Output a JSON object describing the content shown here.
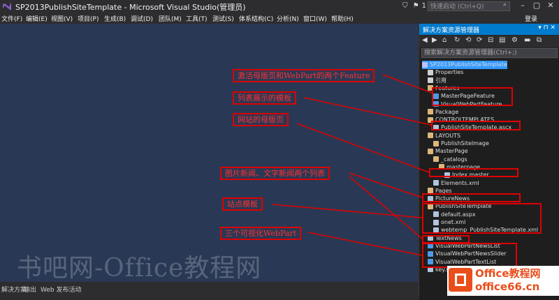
{
  "window": {
    "title": "SP2013PublishSiteTemplate - Microsoft Visual Studio(管理员)",
    "notif_count": "1",
    "quicklaunch_placeholder": "快速启动 (Ctrl+Q)",
    "login": "登录"
  },
  "menu": [
    "文件(F)",
    "编辑(E)",
    "视图(V)",
    "项目(P)",
    "生成(B)",
    "调试(D)",
    "团队(M)",
    "工具(T)",
    "测试(S)",
    "体系结构(C)",
    "分析(N)",
    "窗口(W)",
    "帮助(H)"
  ],
  "solution_explorer": {
    "title": "解决方案资源管理器",
    "search_placeholder": "搜索解决方案资源管理器(Ctrl+;)",
    "items": [
      {
        "label": "SP2013PublishSiteTemplate",
        "icon": "project-icon"
      },
      {
        "label": "Properties",
        "icon": "properties-icon"
      },
      {
        "label": "引用",
        "icon": "references-icon"
      },
      {
        "label": "Features",
        "icon": "folder-icon"
      },
      {
        "label": "MasterPageFeature",
        "icon": "feature-icon"
      },
      {
        "label": "VisualWebPartFeature",
        "icon": "feature-icon"
      },
      {
        "label": "Package",
        "icon": "folder-icon"
      },
      {
        "label": "CONTROLTEMPLATES",
        "icon": "folder-icon"
      },
      {
        "label": "PublishSiteTemplate.ascx",
        "icon": "file-icon"
      },
      {
        "label": "LAYOUTS",
        "icon": "folder-icon"
      },
      {
        "label": "PublishSiteImage",
        "icon": "folder-icon"
      },
      {
        "label": "MasterPage",
        "icon": "folder-icon"
      },
      {
        "label": "_catalogs",
        "icon": "folder-icon"
      },
      {
        "label": "masterpage",
        "icon": "folder-icon"
      },
      {
        "label": "Index.master",
        "icon": "file-icon"
      },
      {
        "label": "Elements.xml",
        "icon": "file-icon"
      },
      {
        "label": "Pages",
        "icon": "folder-icon"
      },
      {
        "label": "PictureNews",
        "icon": "list-icon"
      },
      {
        "label": "PublishSiteTemplate",
        "icon": "folder-icon"
      },
      {
        "label": "default.aspx",
        "icon": "file-icon"
      },
      {
        "label": "onet.xml",
        "icon": "file-icon"
      },
      {
        "label": "webtemp_PublishSiteTemplate.xml",
        "icon": "file-icon"
      },
      {
        "label": "TextNews",
        "icon": "list-icon"
      },
      {
        "label": "VisualWebPartNewsList",
        "icon": "webpart-icon"
      },
      {
        "label": "VisualWebPartNewsSlider",
        "icon": "webpart-icon"
      },
      {
        "label": "VisualWebPartTextList",
        "icon": "webpart-icon"
      },
      {
        "label": "key.snk",
        "icon": "file-icon"
      }
    ]
  },
  "annotations": [
    "激活母版页和WebPart的两个Feature",
    "列表展示的模板",
    "网站的母版页",
    "图片新闻、文字新闻两个列表",
    "站点模板",
    "三个可视化WebPart"
  ],
  "statusbar": [
    "解决方案",
    "输出",
    "Web 发布活动"
  ],
  "watermark": "书吧网-Office教程网",
  "branding": {
    "line1": "Office教程网",
    "line2": "office66.cn"
  },
  "colors": {
    "annotation": "#e00000",
    "accent": "#007acc",
    "editor_bg": "#293955"
  }
}
